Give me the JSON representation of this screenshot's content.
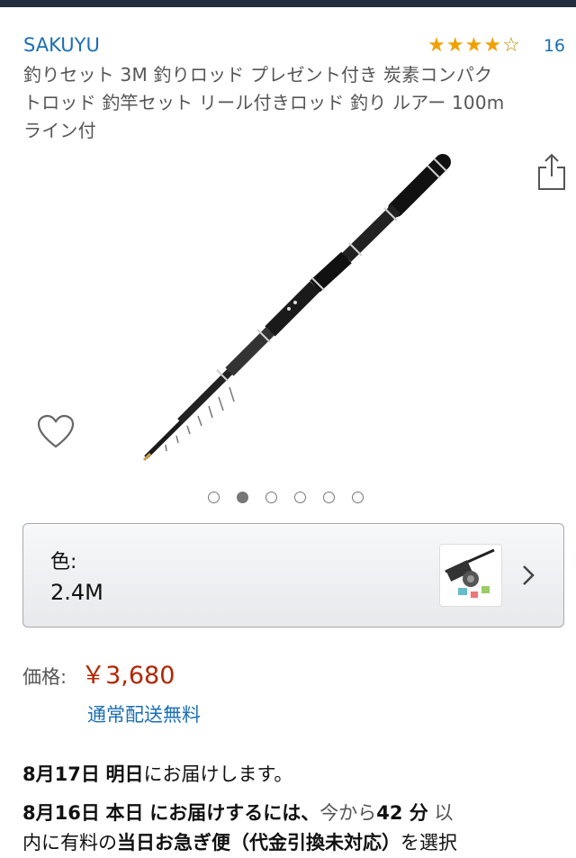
{
  "product": {
    "brand": "SAKUYU",
    "rating": {
      "stars": 4,
      "max": 5,
      "count": "16"
    },
    "title": "釣りセット 3M 釣りロッド プレゼント付き 炭素コンパク\nトロッド 釣竿セット リール付きロッド 釣り ルアー 100m\nライン付",
    "image_name": "telescopic-fishing-rod",
    "carousel": {
      "count": 6,
      "active_index": 1
    }
  },
  "icons": {
    "share": "share-icon",
    "wishlist": "heart-icon",
    "chevron": "chevron-right-icon"
  },
  "variant": {
    "label": "色:",
    "value": "2.4M",
    "thumb": "fishing-set-thumbnail"
  },
  "price": {
    "label": "価格:",
    "value": "￥3,680",
    "shipping": "通常配送無料"
  },
  "delivery": {
    "line1_date": "8月17日",
    "line1_day": "明日",
    "line1_rest": "にお届けします。",
    "line2_date": "8月16日",
    "line2_day": "本日",
    "line2_bold": "にお届けするには、",
    "line2_text": "今から",
    "line2_minutes": "42 分",
    "line2_text2": "以",
    "line3_text": "内に有料の",
    "line3_bold": "当日お急ぎ便（代金引換未対応）",
    "line3_text2": "を選択"
  },
  "colors": {
    "link": "#1a6fb5",
    "price": "#b12704",
    "star": "#f0a000",
    "topbar": "#232f3e"
  }
}
